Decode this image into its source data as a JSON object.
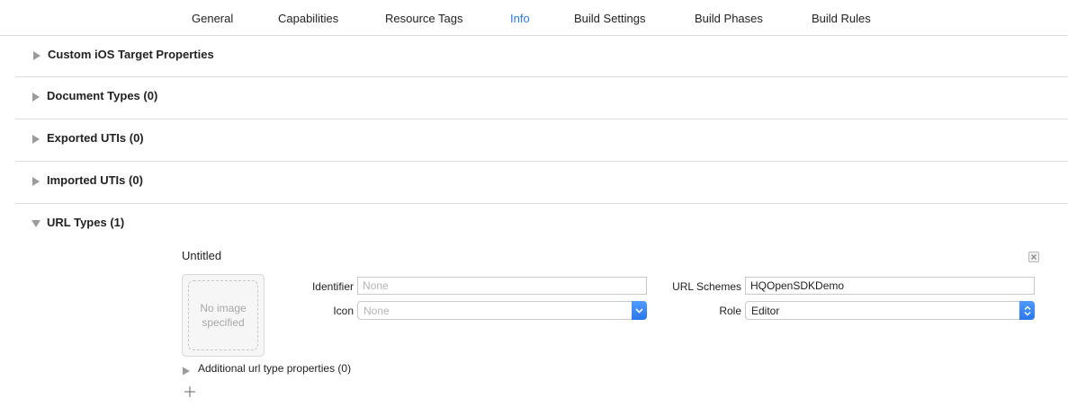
{
  "tabs": [
    {
      "label": "General"
    },
    {
      "label": "Capabilities"
    },
    {
      "label": "Resource Tags"
    },
    {
      "label": "Info",
      "active": true
    },
    {
      "label": "Build Settings"
    },
    {
      "label": "Build Phases"
    },
    {
      "label": "Build Rules"
    }
  ],
  "sections": [
    {
      "title": "Custom iOS Target Properties",
      "expanded": false
    },
    {
      "title": "Document Types (0)",
      "expanded": false
    },
    {
      "title": "Exported UTIs (0)",
      "expanded": false
    },
    {
      "title": "Imported UTIs (0)",
      "expanded": false
    },
    {
      "title": "URL Types (1)",
      "expanded": true
    }
  ],
  "url_type": {
    "name": "Untitled",
    "image_placeholder": "No image specified",
    "identifier_label": "Identifier",
    "identifier_value": "",
    "identifier_placeholder": "None",
    "icon_label": "Icon",
    "icon_value": "None",
    "url_schemes_label": "URL Schemes",
    "url_schemes_value": "HQOpenSDKDemo",
    "role_label": "Role",
    "role_value": "Editor",
    "additional_label": "Additional url type properties (0)"
  },
  "colors": {
    "accent": "#2d7bf3",
    "divider": "#dcdcdc",
    "placeholder": "#b5b5b5"
  },
  "icons": {
    "collapsed": "disclosure-right-icon",
    "expanded": "disclosure-down-icon",
    "delete": "delete-box-icon",
    "add": "plus-icon",
    "popup": "chevron-down-icon",
    "stepper": "updown-chevron-icon"
  }
}
